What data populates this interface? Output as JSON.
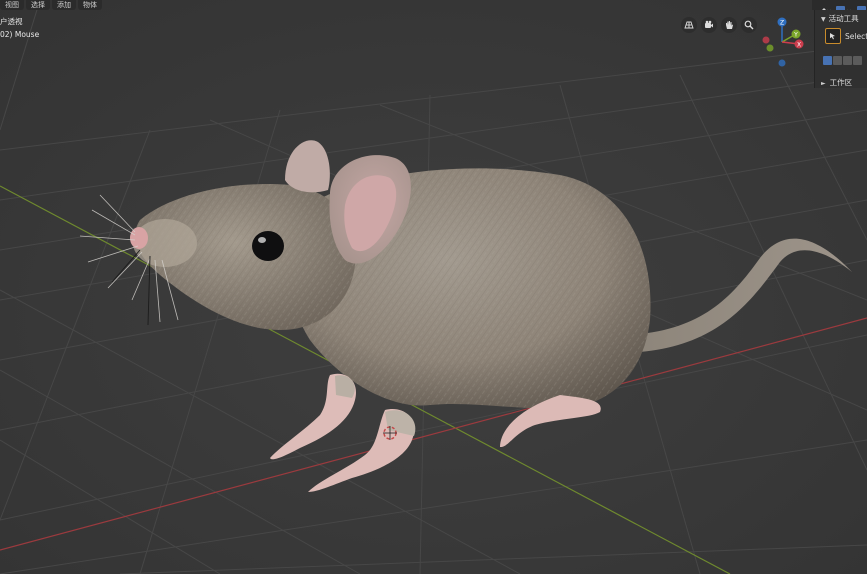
{
  "header": {
    "menu": [
      "视图",
      "选择",
      "添加",
      "物体"
    ]
  },
  "viewport": {
    "view_name": "户透视",
    "object_info": "02) Mouse"
  },
  "sidebar": {
    "active_tool_title": "活动工具",
    "select_label": "Select",
    "workspace_title": "工作区"
  },
  "gizmo": {
    "z_label": "Z",
    "y_label": "Y",
    "x_label": "X"
  },
  "colors": {
    "background": "#3a3a3a",
    "grid": "#454545",
    "x_axis": "#9b3a3e",
    "y_axis": "#6f8a2e",
    "panel": "#303030",
    "accent_active": "#4772b3",
    "select_outline": "#c98c2c"
  },
  "icons": [
    "grid-view-icon",
    "camera-icon",
    "hand-pan-icon",
    "zoom-icon",
    "select-cursor-icon"
  ]
}
